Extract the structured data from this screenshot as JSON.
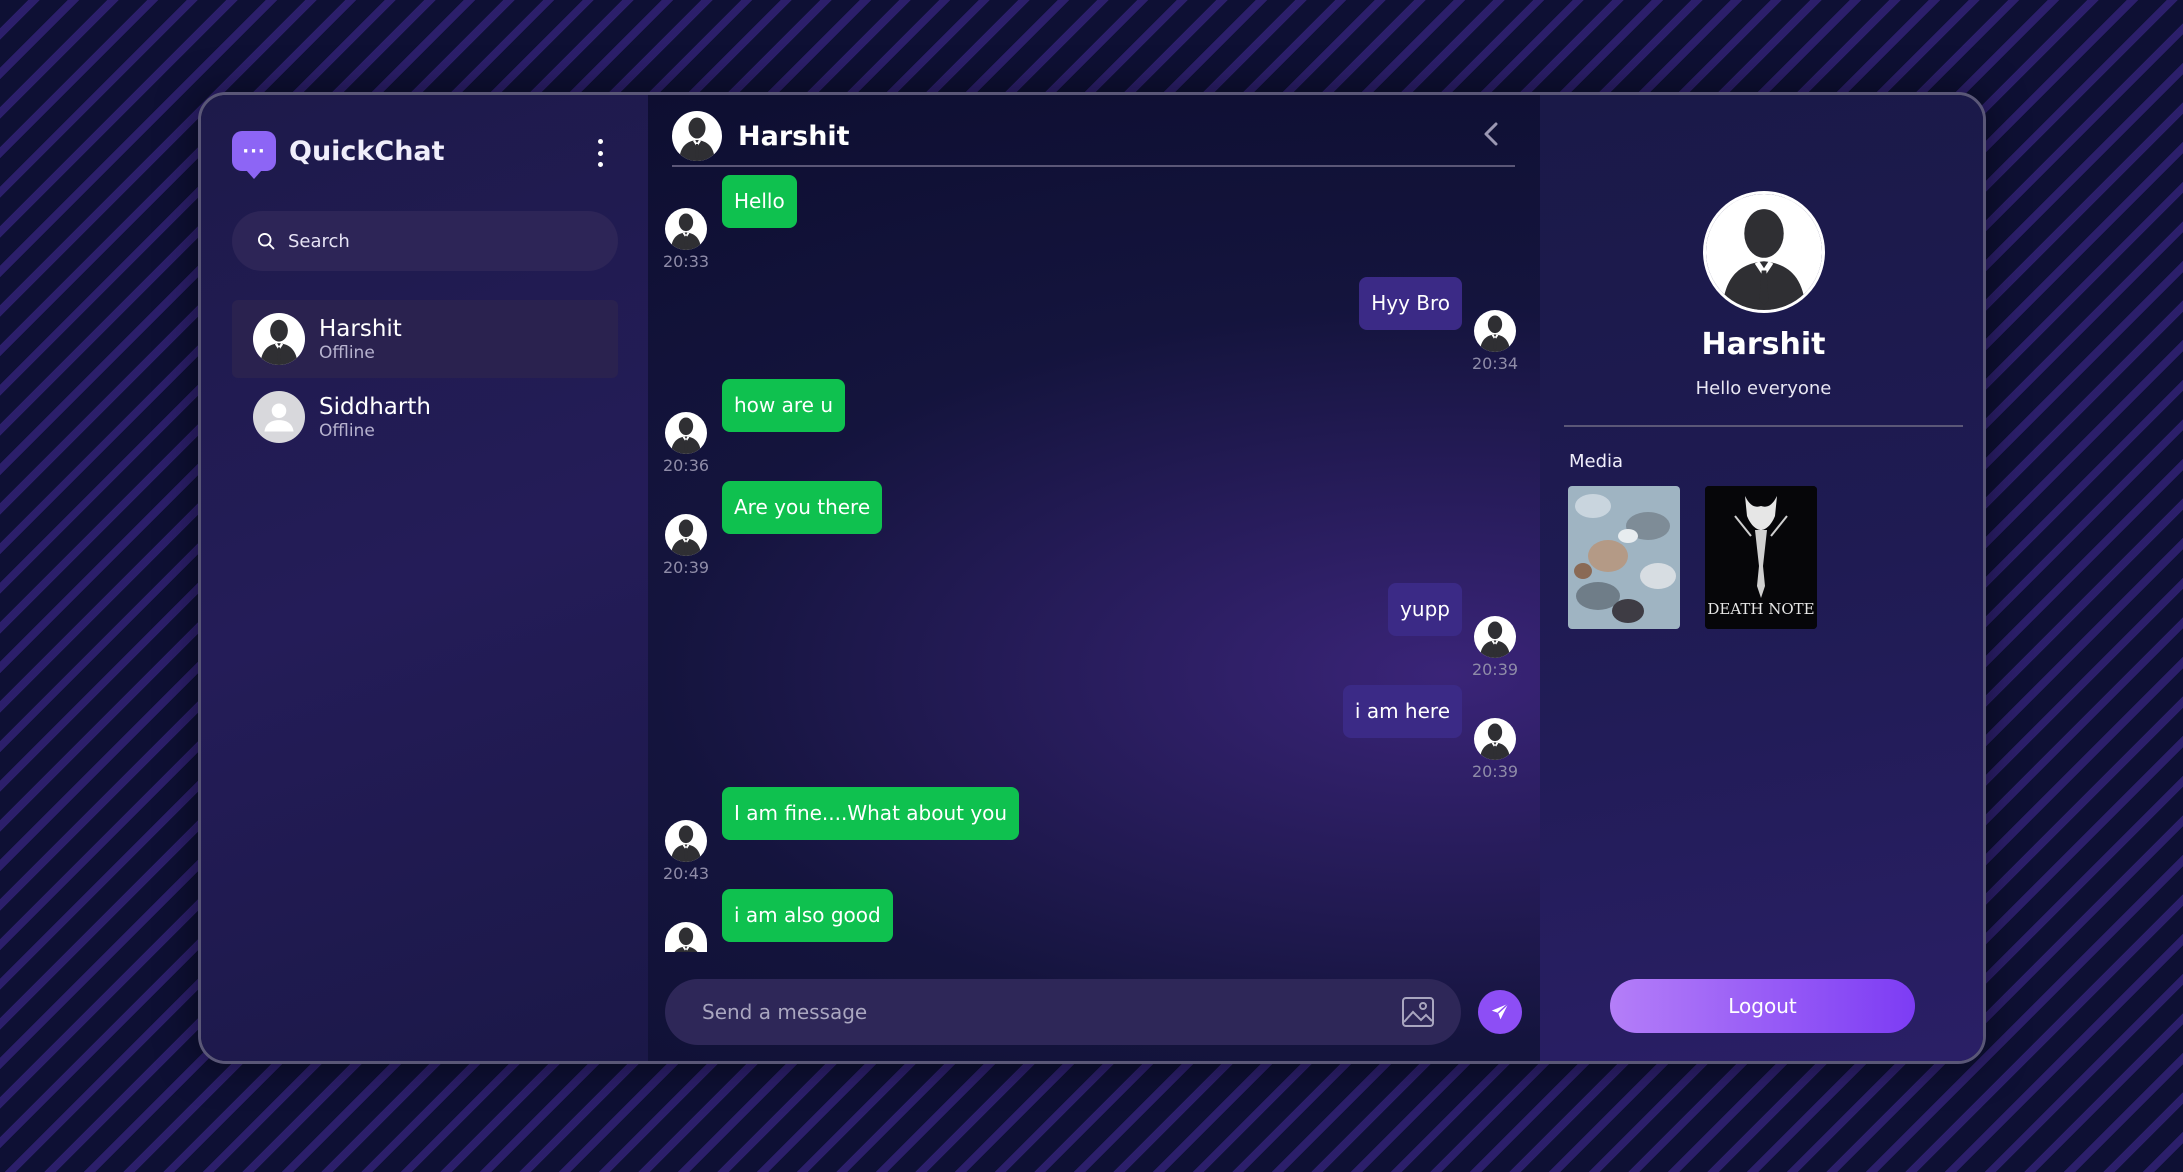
{
  "app": {
    "name": "QuickChat"
  },
  "sidebar": {
    "search_placeholder": "Search",
    "contacts": [
      {
        "name": "Harshit",
        "status": "Offline",
        "avatar": "suit-silhouette-avatar",
        "active": true
      },
      {
        "name": "Siddharth",
        "status": "Offline",
        "avatar": "default-user-avatar",
        "active": false
      }
    ]
  },
  "chat": {
    "contact_name": "Harshit",
    "messages": [
      {
        "text": "Hello",
        "direction": "received",
        "time": "20:33"
      },
      {
        "text": "Hyy Bro",
        "direction": "sent",
        "time": "20:34"
      },
      {
        "text": "how are u",
        "direction": "received",
        "time": "20:36"
      },
      {
        "text": "Are you there",
        "direction": "received",
        "time": "20:39"
      },
      {
        "text": "yupp",
        "direction": "sent",
        "time": "20:39"
      },
      {
        "text": "i am here",
        "direction": "sent",
        "time": "20:39"
      },
      {
        "text": "I am fine....What about you",
        "direction": "received",
        "time": "20:43"
      },
      {
        "text": "i am also good",
        "direction": "received",
        "time": ""
      }
    ],
    "composer_placeholder": "Send a message"
  },
  "profile": {
    "name": "Harshit",
    "bio": "Hello everyone",
    "media_label": "Media",
    "media": [
      {
        "name": "anime-crowd-thumbnail"
      },
      {
        "name": "death-note-thumbnail",
        "caption": "DEATH NOTE"
      }
    ],
    "logout_label": "Logout"
  },
  "colors": {
    "accent": "#8d65f5",
    "received_bubble": "#0fc14f",
    "sent_bubble": "#3b2a86",
    "logout_gradient_start": "#b47ef8",
    "logout_gradient_end": "#7d3cf4"
  }
}
